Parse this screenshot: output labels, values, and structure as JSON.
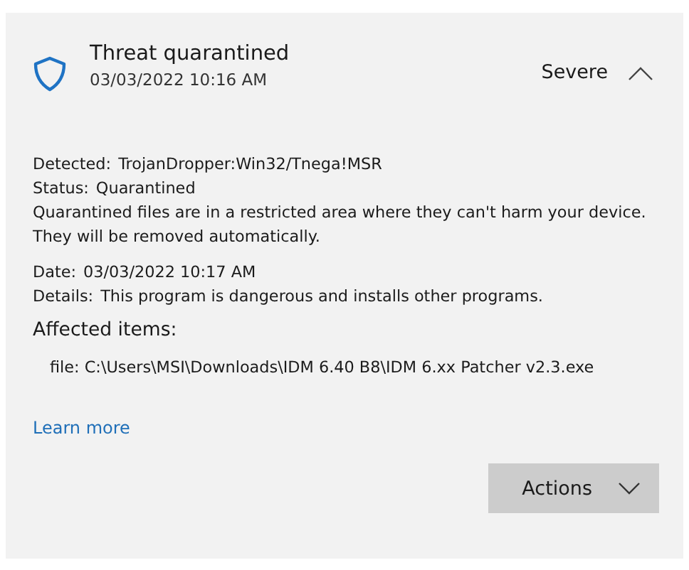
{
  "threat": {
    "title": "Threat quarantined",
    "timestamp": "03/03/2022 10:16 AM",
    "severity": "Severe",
    "expanded": true
  },
  "details": [
    {
      "label": "Detected:",
      "value": "TrojanDropper:Win32/Tnega!MSR"
    },
    {
      "label": "Status:",
      "value": "Quarantined"
    }
  ],
  "status_note": "Quarantined files are in a restricted area where they can't harm your device. They will be removed automatically.",
  "details_2": [
    {
      "label": "Date:",
      "value": "03/03/2022 10:17 AM"
    },
    {
      "label": "Details:",
      "value": "This program is dangerous and installs other programs."
    }
  ],
  "affected_items": {
    "heading": "Affected items:",
    "items": [
      "file: C:\\Users\\MSI\\Downloads\\IDM 6.40 B8\\IDM 6.xx Patcher v2.3.exe"
    ]
  },
  "learn_more": "Learn more",
  "actions_button": "Actions"
}
